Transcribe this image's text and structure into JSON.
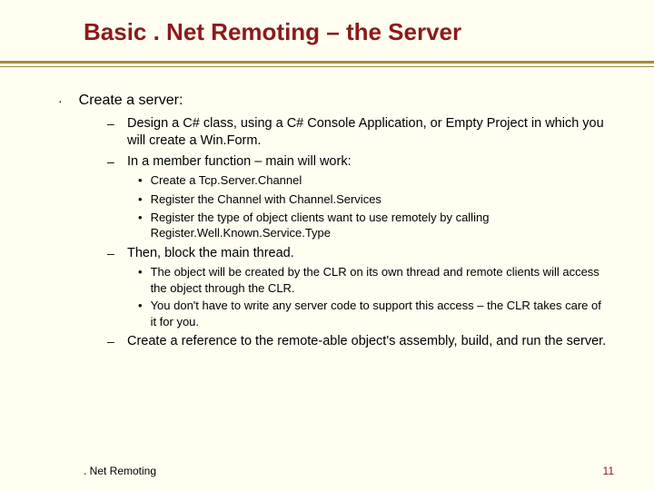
{
  "title": "Basic . Net Remoting – the Server",
  "level1": {
    "text": "Create a server:"
  },
  "level2": [
    {
      "text": "Design a C# class, using a C# Console Application, or Empty Project in which you will create a Win.Form."
    },
    {
      "text": "In a member function – main will work:",
      "children": [
        "Create a Tcp.Server.Channel",
        "Register the Channel with Channel.Services",
        "Register the type of object clients want to use remotely by calling Register.Well.Known.Service.Type"
      ]
    },
    {
      "text": "Then, block the main thread.",
      "children": [
        "The object will be created by the CLR on its own thread and remote clients will access the object through the CLR.",
        "You don't have to write any server code to support this access – the CLR takes care of it for you."
      ]
    },
    {
      "text": "Create a reference to the remote-able object's assembly, build, and run the server."
    }
  ],
  "footer": {
    "label": ". Net Remoting",
    "page": "11"
  }
}
